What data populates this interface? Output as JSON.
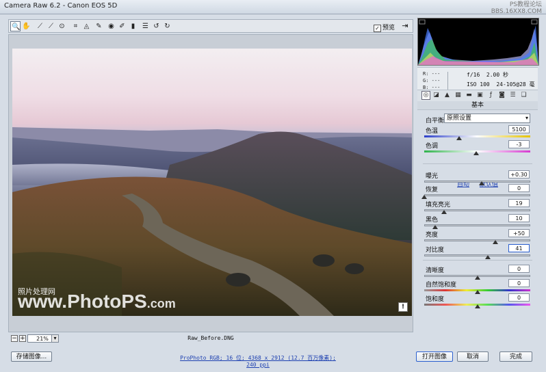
{
  "window": {
    "title": "Camera Raw 6.2 -  Canon EOS 5D",
    "watermark_line1": "PS教程论坛",
    "watermark_line2": "BBS.16XX8.COM"
  },
  "toolbar": {
    "tools": [
      {
        "name": "zoom-tool",
        "glyph": "🔍"
      },
      {
        "name": "hand-tool",
        "glyph": "✋"
      },
      {
        "name": "white-balance-tool",
        "glyph": "⟋"
      },
      {
        "name": "color-sampler-tool",
        "glyph": "⟋"
      },
      {
        "name": "targeted-adjustment-tool",
        "glyph": "⊙"
      },
      {
        "name": "crop-tool",
        "glyph": "⌗"
      },
      {
        "name": "straighten-tool",
        "glyph": "◬"
      },
      {
        "name": "spot-removal-tool",
        "glyph": "✎"
      },
      {
        "name": "red-eye-tool",
        "glyph": "◉"
      },
      {
        "name": "adjustment-brush-tool",
        "glyph": "✐"
      },
      {
        "name": "graduated-filter-tool",
        "glyph": "▮"
      },
      {
        "name": "preferences-tool",
        "glyph": "☰"
      },
      {
        "name": "rotate-left-tool",
        "glyph": "↺"
      },
      {
        "name": "rotate-right-tool",
        "glyph": "↻"
      }
    ],
    "preview_label": "预览",
    "preview_checked": "✓"
  },
  "image": {
    "watermark_cn": "照片处理网",
    "watermark_main": "www.PhotoPS",
    "watermark_suffix": ".com",
    "warning_glyph": "!"
  },
  "status": {
    "zoom_minus": "−",
    "zoom_plus": "+",
    "zoom": "21%",
    "filename": "Raw_Before.DNG"
  },
  "footer": {
    "save_label": "存储图像...",
    "workflow": "ProPhoto RGB; 16 位; 4368 x 2912 (12.7 百万像素); 240 ppi",
    "open_label": "打开图像",
    "cancel_label": "取消",
    "done_label": "完成"
  },
  "readout": {
    "r": "R:  ---",
    "g": "G:  ---",
    "b": "B:  ---",
    "aperture": "f/16",
    "shutter": "2.00 秒",
    "iso": "ISO 100",
    "lens": "24-105@28 毫米"
  },
  "panel": {
    "section_title": "基本",
    "wb_label": "白平衡:",
    "wb_value": "原照设置",
    "auto_label": "自动",
    "default_label": "默认值",
    "sliders": [
      {
        "key": "temperature",
        "label": "色温",
        "value": "5100",
        "pos": 0.33
      },
      {
        "key": "tint",
        "label": "色调",
        "value": "-3",
        "pos": 0.49
      },
      {
        "key": "exposure",
        "label": "曝光",
        "value": "+0.30",
        "pos": 0.54
      },
      {
        "key": "recovery",
        "label": "恢复",
        "value": "0",
        "pos": 0.0
      },
      {
        "key": "fill-light",
        "label": "填充亮光",
        "value": "19",
        "pos": 0.19
      },
      {
        "key": "blacks",
        "label": "黑色",
        "value": "10",
        "pos": 0.1
      },
      {
        "key": "brightness",
        "label": "亮度",
        "value": "+50",
        "pos": 0.67
      },
      {
        "key": "contrast",
        "label": "对比度",
        "value": "41",
        "pos": 0.6
      },
      {
        "key": "clarity",
        "label": "清晰度",
        "value": "0",
        "pos": 0.5
      },
      {
        "key": "vibrance",
        "label": "自然饱和度",
        "value": "0",
        "pos": 0.5
      },
      {
        "key": "saturation",
        "label": "饱和度",
        "value": "0",
        "pos": 0.5
      }
    ]
  },
  "colors": {
    "accent": "#1c3fb0",
    "panel_bg": "#d6dde6"
  }
}
